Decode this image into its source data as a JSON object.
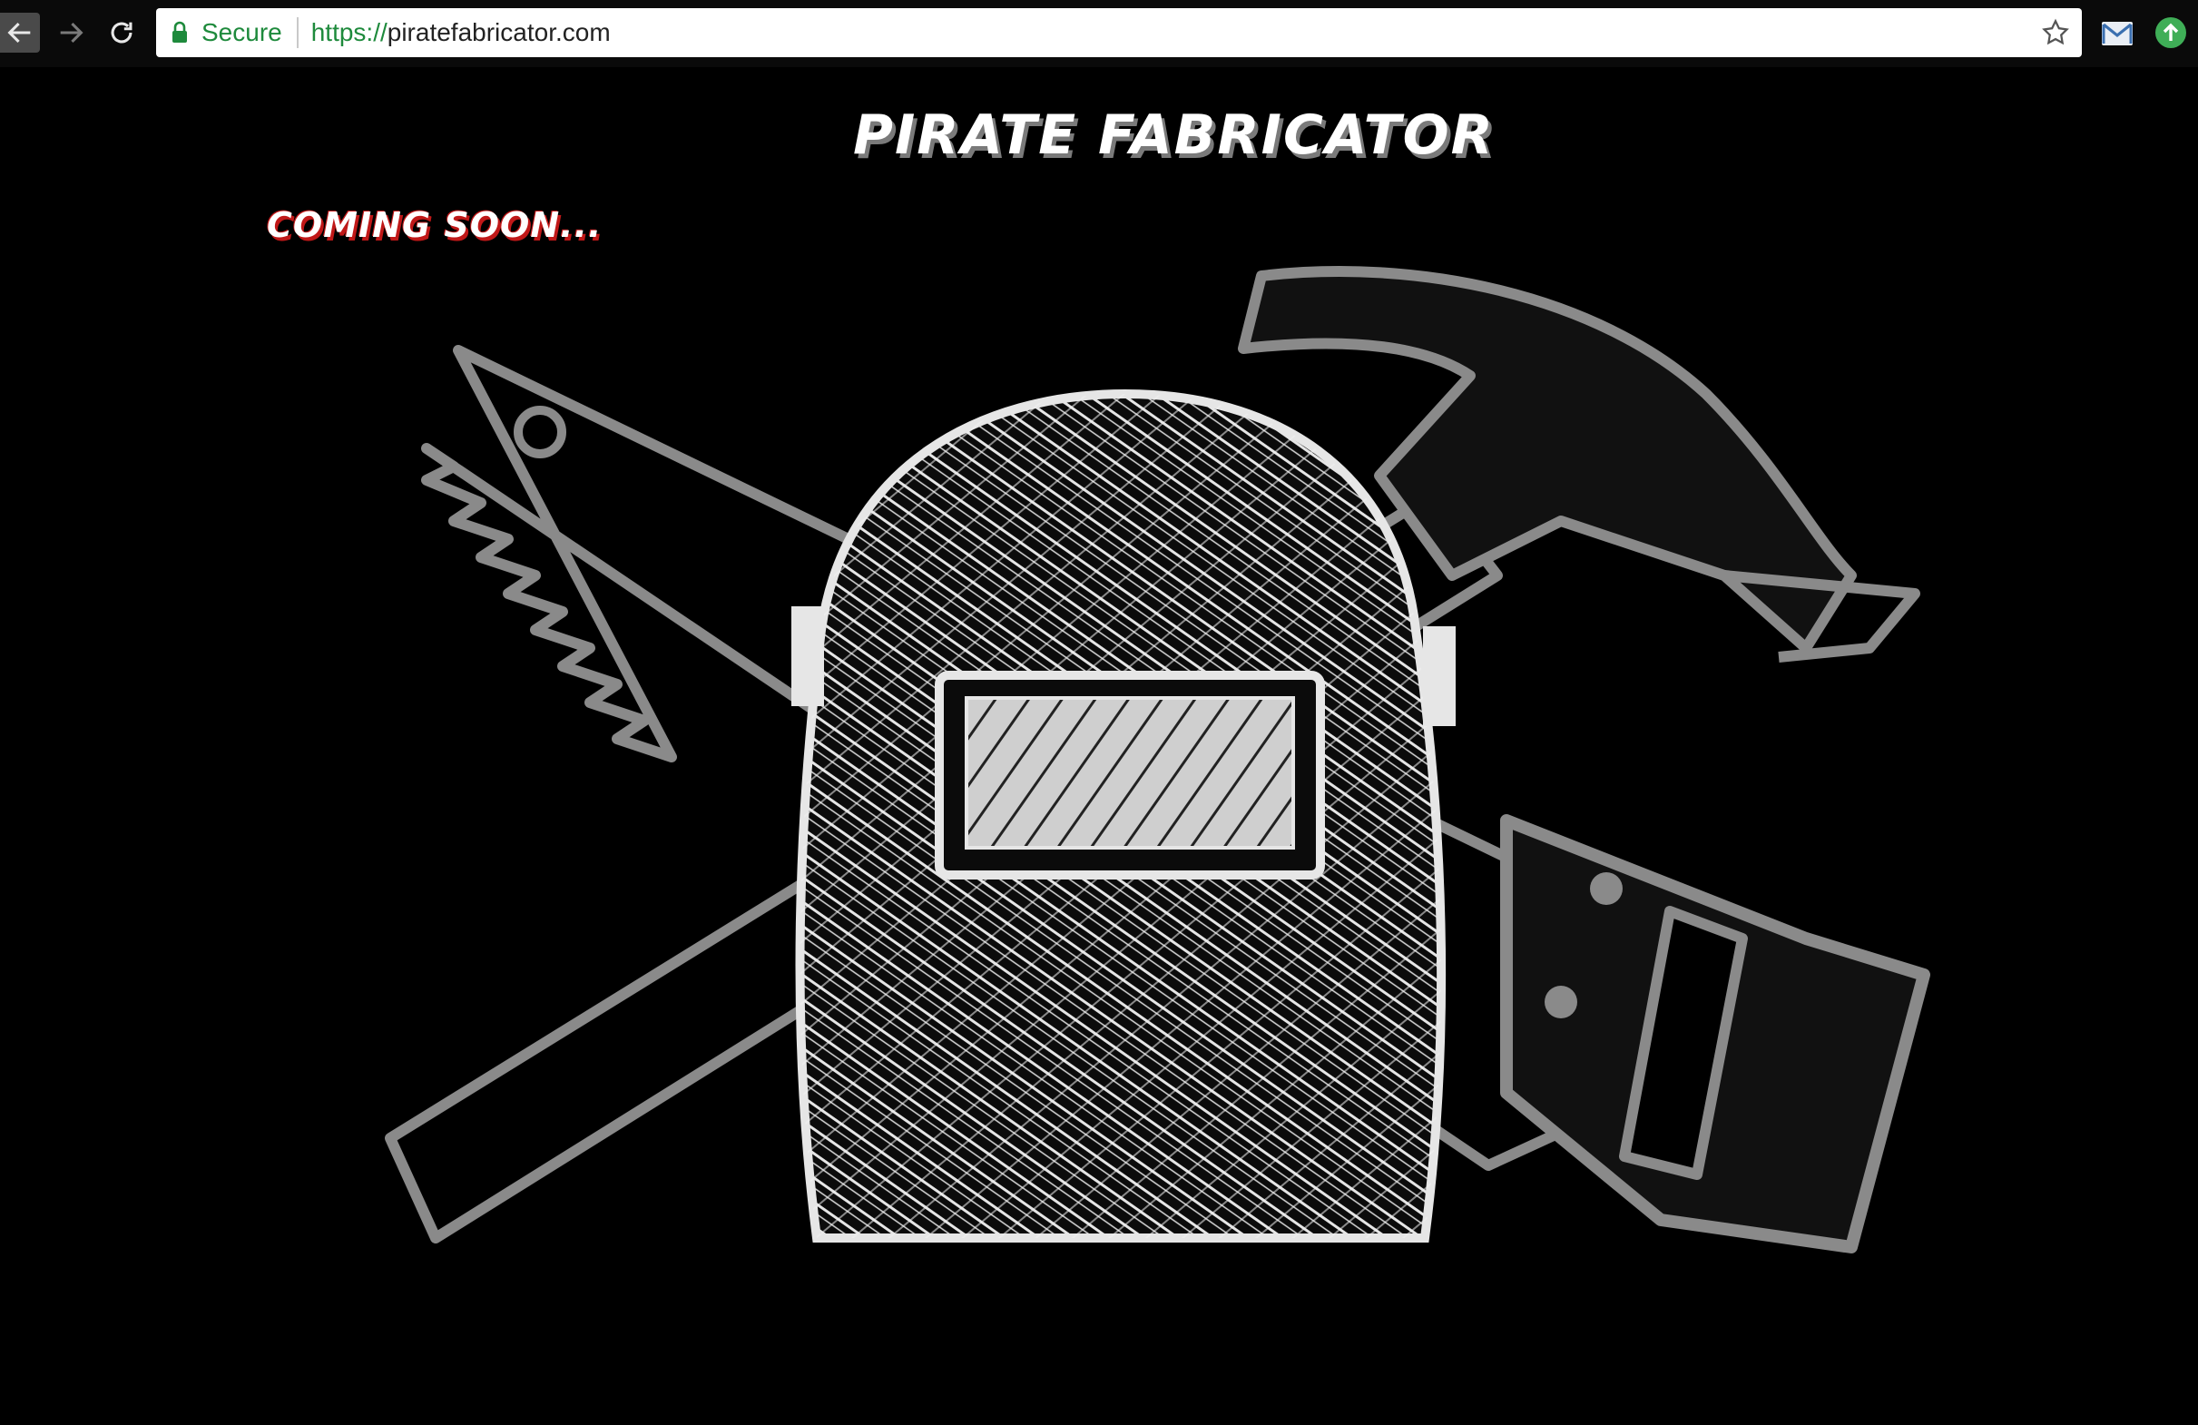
{
  "browser": {
    "secure_label": "Secure",
    "url_scheme": "https://",
    "url_host": "piratefabricator.com",
    "icons": {
      "back": "back-arrow-icon",
      "forward": "forward-arrow-icon",
      "reload": "reload-icon",
      "lock": "lock-icon",
      "bookmark": "star-icon",
      "extension_mail": "gmail-icon",
      "extension_update": "green-update-icon"
    },
    "colors": {
      "secure_green": "#1e8a3c",
      "chrome_bg": "#0a0a0a"
    }
  },
  "page": {
    "title": "PIRATE FABRICATOR",
    "tagline": "COMING SOON...",
    "colors": {
      "background": "#000000",
      "title_text": "#ffffff",
      "tagline_shadow": "#c01818",
      "artwork_gray": "#8a8a8a",
      "helmet_white": "#e6e6e6"
    },
    "artwork": {
      "subject": "welding-helmet-crossed-saw-and-hammer"
    }
  }
}
